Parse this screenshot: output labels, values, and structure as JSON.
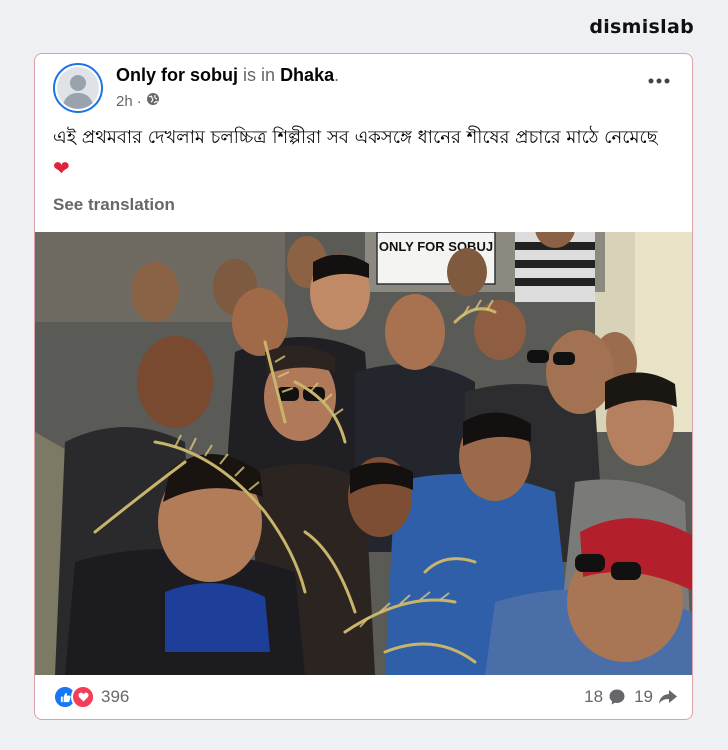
{
  "brand": "dismislab",
  "post": {
    "author": "Only for sobuj",
    "is_in": "is in",
    "location": "Dhaka",
    "punct": ".",
    "time": "2h",
    "dot": "·",
    "text": "এই প্রথমবার দেখলাম চলচ্চিত্র শিল্পীরা সব একসঙ্গে ধানের শীষের প্রচারে মাঠে নেমেছে",
    "heart": "❤",
    "see_translation": "See translation",
    "sign_text": "ONLY FOR SOBUJ"
  },
  "footer": {
    "reaction_count": "396",
    "comment_count": "18",
    "share_count": "19"
  },
  "icons": {
    "like": "like-icon",
    "love": "love-icon",
    "globe": "globe-icon",
    "comment": "comment-icon",
    "share": "share-icon",
    "more": "more-icon"
  },
  "colors": {
    "accent": "#1877f2",
    "love": "#f33e58",
    "card_border": "#d9a2a8"
  }
}
